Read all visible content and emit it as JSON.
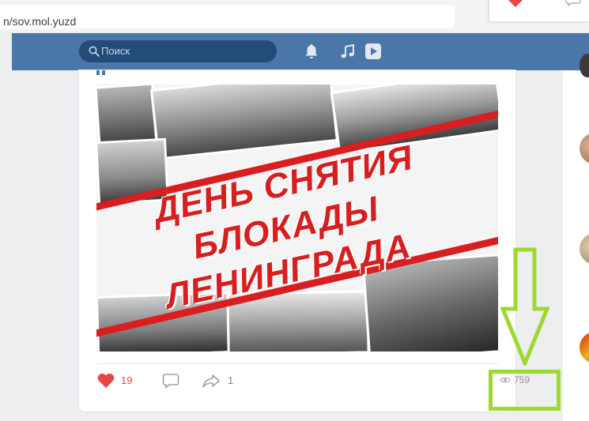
{
  "browser": {
    "url": "n/sov.mol.yuzd"
  },
  "header": {
    "search_placeholder": "Поиск",
    "bg_color": "#4a76a8",
    "icons": [
      "search-icon",
      "bell-icon",
      "music-icon",
      "play-icon"
    ]
  },
  "post": {
    "image_title_lines": [
      "ДЕНЬ СНЯТИЯ",
      "БЛОКАДЫ",
      "ЛЕНИНГРАДА"
    ],
    "accent_color": "#d81e1e",
    "likes": "19",
    "shares": "1",
    "views": "759",
    "icons": [
      "heart-icon",
      "comment-icon",
      "share-icon",
      "eye-icon"
    ]
  },
  "annotation": {
    "color": "#9ed92f",
    "shapes": [
      "down-arrow",
      "highlight-box"
    ]
  }
}
